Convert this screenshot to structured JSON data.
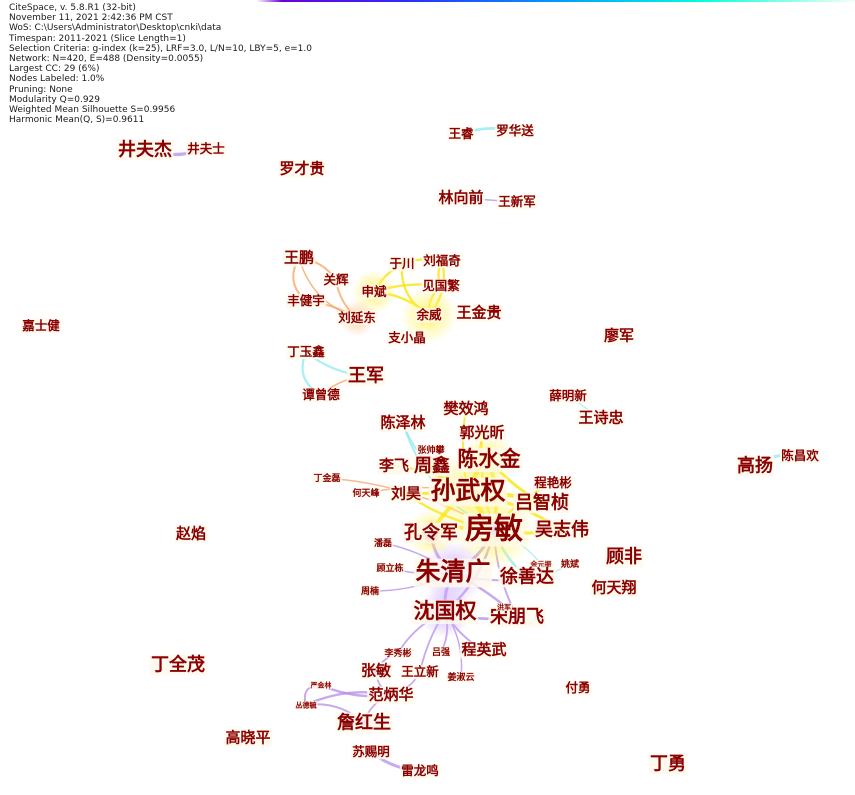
{
  "app": {
    "title": "CiteSpace, v. 5.8.R1 (32-bit)"
  },
  "info_lines": [
    "CiteSpace, v. 5.8.R1 (32-bit)",
    "November 11, 2021 2:42:36 PM CST",
    "WoS: C:\\Users\\Administrator\\Desktop\\cnki\\data",
    "Timespan: 2011-2021 (Slice Length=1)",
    "Selection Criteria: g-index (k=25), LRF=3.0, L/N=10, LBY=5, e=1.0",
    "Network: N=420, E=488 (Density=0.0055)",
    "Largest CC: 29 (6%)",
    "Nodes Labeled: 1.0%",
    "Pruning: None",
    "Modularity Q=0.929",
    "Weighted Mean Silhouette S=0.9956",
    "Harmonic Mean(Q, S)=0.9611"
  ],
  "colors": {
    "label": "#8b0000",
    "timeline_start": "#6a00d8",
    "timeline_mid": "#00a0ff",
    "timeline_end": "#00ffdc",
    "link_yellow": "#f5e400",
    "link_orange": "#f4a460",
    "link_purple": "#b48ce8",
    "link_cyan": "#8fe8f0",
    "node_purple": "#7b68ee",
    "node_orange": "#e8833a",
    "node_yellow": "#f2d500"
  },
  "labels": [
    {
      "id": "jingfujie",
      "text": "井夫杰",
      "size": "large"
    },
    {
      "id": "jingfushi",
      "text": "井夫士",
      "size": "small"
    },
    {
      "id": "luocaigui",
      "text": "罗才贵",
      "size": "medium"
    },
    {
      "id": "wangrui",
      "text": "王睿",
      "size": "small"
    },
    {
      "id": "luohuasong",
      "text": "罗华送",
      "size": "small"
    },
    {
      "id": "linxiangqian",
      "text": "林向前",
      "size": "medium"
    },
    {
      "id": "wangxinjun",
      "text": "王新军",
      "size": "small"
    },
    {
      "id": "wangpeng",
      "text": "王鹏",
      "size": "medium"
    },
    {
      "id": "guanhui",
      "text": "关辉",
      "size": "small"
    },
    {
      "id": "yuchuan",
      "text": "于川",
      "size": "small"
    },
    {
      "id": "liufuqi",
      "text": "刘福奇",
      "size": "small"
    },
    {
      "id": "shenbin",
      "text": "申斌",
      "size": "small"
    },
    {
      "id": "jianguofan",
      "text": "见国繁",
      "size": "small"
    },
    {
      "id": "fengjianyu",
      "text": "丰健宇",
      "size": "small"
    },
    {
      "id": "liuyandong",
      "text": "刘延东",
      "size": "small"
    },
    {
      "id": "yuwei",
      "text": "余威",
      "size": "small"
    },
    {
      "id": "wangjingui",
      "text": "王金贵",
      "size": "medium"
    },
    {
      "id": "zhixiaojing",
      "text": "支小晶",
      "size": "small"
    },
    {
      "id": "jiashijian",
      "text": "嘉士健",
      "size": "small"
    },
    {
      "id": "liaojun",
      "text": "廖军",
      "size": "medium"
    },
    {
      "id": "dingyuxin",
      "text": "丁玉鑫",
      "size": "small"
    },
    {
      "id": "wangjun",
      "text": "王军",
      "size": "large"
    },
    {
      "id": "tanzengde",
      "text": "谭曾德",
      "size": "small"
    },
    {
      "id": "xuemingxin",
      "text": "薛明新",
      "size": "small"
    },
    {
      "id": "wangshizhong",
      "text": "王诗忠",
      "size": "medium"
    },
    {
      "id": "fanxiaohong",
      "text": "樊效鸿",
      "size": "medium"
    },
    {
      "id": "chenzelin",
      "text": "陈泽林",
      "size": "medium"
    },
    {
      "id": "guoguangxin",
      "text": "郭光昕",
      "size": "medium"
    },
    {
      "id": "zhangshuaipan",
      "text": "张帅攀",
      "size": "tiny"
    },
    {
      "id": "lifei",
      "text": "李飞",
      "size": "medium"
    },
    {
      "id": "zhouxin",
      "text": "周鑫",
      "size": "large"
    },
    {
      "id": "chenshuijin",
      "text": "陈水金",
      "size": "xlarge"
    },
    {
      "id": "chengyanbin",
      "text": "程艳彬",
      "size": "small"
    },
    {
      "id": "gaoyang",
      "text": "高扬",
      "size": "large"
    },
    {
      "id": "chenchanghuan",
      "text": "陈昌欢",
      "size": "small"
    },
    {
      "id": "dingjinlei",
      "text": "丁金磊",
      "size": "tiny"
    },
    {
      "id": "hetianfeng",
      "text": "何天峰",
      "size": "tiny"
    },
    {
      "id": "liuhao",
      "text": "刘昊",
      "size": "medium"
    },
    {
      "id": "sunwuquan",
      "text": "孙武权",
      "size": "xxlarge"
    },
    {
      "id": "lvzhizhen",
      "text": "吕智桢",
      "size": "large"
    },
    {
      "id": "zhaoyan",
      "text": "赵焰",
      "size": "medium"
    },
    {
      "id": "konglingjun",
      "text": "孔令军",
      "size": "large"
    },
    {
      "id": "fangmin",
      "text": "房敏",
      "size": "huge"
    },
    {
      "id": "wuzhiwei",
      "text": "吴志伟",
      "size": "large"
    },
    {
      "id": "panlei",
      "text": "潘磊",
      "size": "tiny"
    },
    {
      "id": "gufei",
      "text": "顾非",
      "size": "large"
    },
    {
      "id": "yuanzhen",
      "text": "余元振",
      "size": "micro"
    },
    {
      "id": "yaobin",
      "text": "姚斌",
      "size": "tiny"
    },
    {
      "id": "gulidong",
      "text": "顾立栋",
      "size": "tiny"
    },
    {
      "id": "zhuqingguang",
      "text": "朱清广",
      "size": "xxlarge"
    },
    {
      "id": "xushanda",
      "text": "徐善达",
      "size": "large"
    },
    {
      "id": "hetianxiang",
      "text": "何天翔",
      "size": "medium"
    },
    {
      "id": "zhounan",
      "text": "周楠",
      "size": "tiny"
    },
    {
      "id": "shenguoquan",
      "text": "沈国权",
      "size": "xlarge"
    },
    {
      "id": "songpengfei",
      "text": "宋朋飞",
      "size": "large"
    },
    {
      "id": "hongjun",
      "text": "洪军",
      "size": "micro"
    },
    {
      "id": "chengyingwu",
      "text": "程英武",
      "size": "medium"
    },
    {
      "id": "dingquanmao",
      "text": "丁全茂",
      "size": "large"
    },
    {
      "id": "lixiubin",
      "text": "李秀彬",
      "size": "tiny"
    },
    {
      "id": "lvqiang",
      "text": "吕强",
      "size": "tiny"
    },
    {
      "id": "zhangmin",
      "text": "张敏",
      "size": "medium"
    },
    {
      "id": "wanglixin",
      "text": "王立新",
      "size": "small"
    },
    {
      "id": "jiangshuyun",
      "text": "姜淑云",
      "size": "tiny"
    },
    {
      "id": "yanjinlin",
      "text": "严金林",
      "size": "micro"
    },
    {
      "id": "congdeyu",
      "text": "丛德毓",
      "size": "micro"
    },
    {
      "id": "fanbinghua",
      "text": "范炳华",
      "size": "medium"
    },
    {
      "id": "fuyong",
      "text": "付勇",
      "size": "small"
    },
    {
      "id": "gaoxiaoping",
      "text": "高晓平",
      "size": "medium"
    },
    {
      "id": "zhanhongsheng",
      "text": "詹红生",
      "size": "large"
    },
    {
      "id": "suciming",
      "text": "苏赐明",
      "size": "small"
    },
    {
      "id": "leilongming",
      "text": "雷龙鸣",
      "size": "small"
    },
    {
      "id": "dingyong",
      "text": "丁勇",
      "size": "large"
    }
  ]
}
